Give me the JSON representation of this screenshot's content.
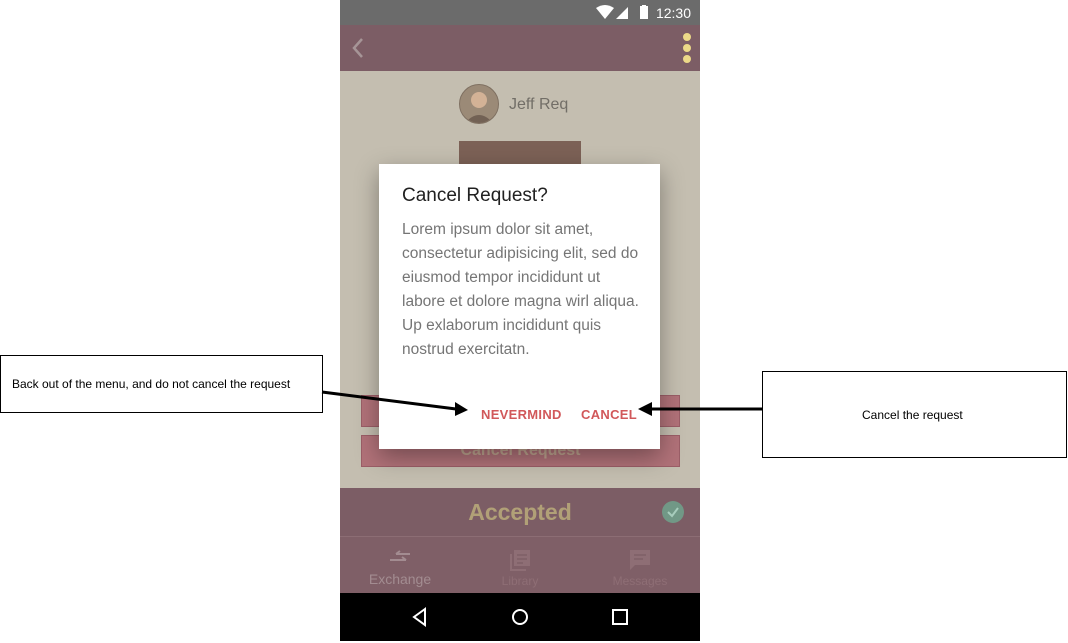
{
  "status_bar": {
    "time": "12:30"
  },
  "app_bar": {
    "back_icon": "chevron-left-icon",
    "menu_icon": "overflow-dots-icon",
    "menu_icon_color": "#f3e08a"
  },
  "profile": {
    "name": "Jeff Req"
  },
  "dialog": {
    "title": "Cancel Request?",
    "body": "Lorem ipsum dolor sit amet, consectetur adipisicing elit, sed do eiusmod tempor incididunt ut labore et dolore magna wirl aliqua. Up exlaborum incididunt quis nostrud exercitatn.",
    "nevermind_label": "NEVERMIND",
    "cancel_label": "CANCEL",
    "button_color": "#d1585a"
  },
  "background_buttons": {
    "cancel_request_label": "Cancel Request"
  },
  "status_strip": {
    "label": "Accepted",
    "check_icon": "check-circle-icon"
  },
  "bottom_nav": {
    "items": [
      {
        "label": "Exchange",
        "icon": "swap-arrows-icon"
      },
      {
        "label": "Library",
        "icon": "library-icon"
      },
      {
        "label": "Messages",
        "icon": "message-icon"
      }
    ]
  },
  "system_nav": {
    "back": "back-triangle-icon",
    "home": "home-circle-icon",
    "recents": "recents-square-icon"
  },
  "annotations": {
    "left_callout": "Back out of the menu, and do not cancel the request",
    "right_callout": "Cancel the request"
  }
}
